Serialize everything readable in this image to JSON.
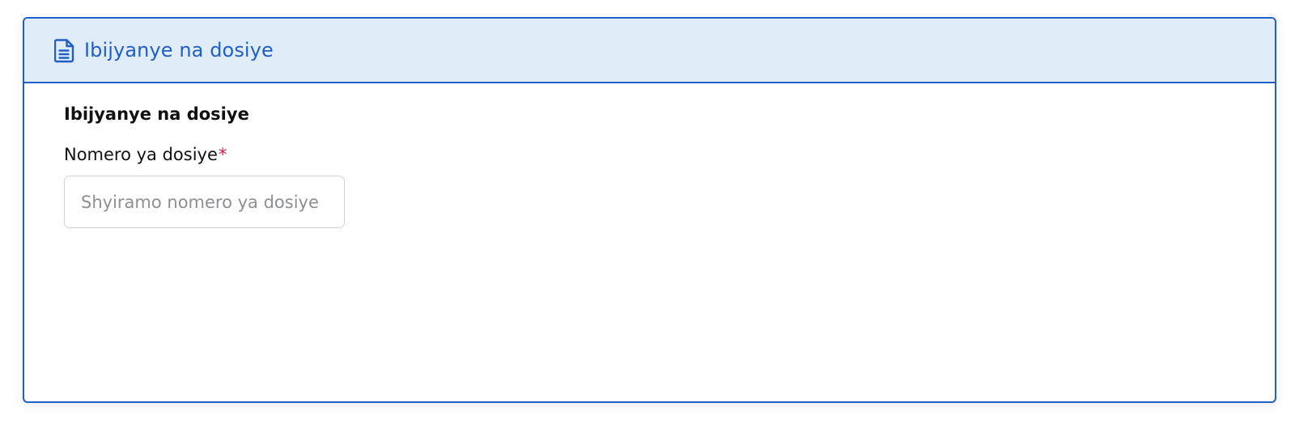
{
  "panel": {
    "header_title": "Ibijyanye na dosiye",
    "header_icon": "file-text-icon",
    "accent_color": "#1f5fc8",
    "header_bg_color": "#e0ecf8"
  },
  "form": {
    "section_title": "Ibijyanye na dosiye",
    "file_number": {
      "label": "Nomero ya dosiye",
      "required_mark": "*",
      "value": "",
      "placeholder": "Shyiramo nomero ya dosiye"
    }
  }
}
